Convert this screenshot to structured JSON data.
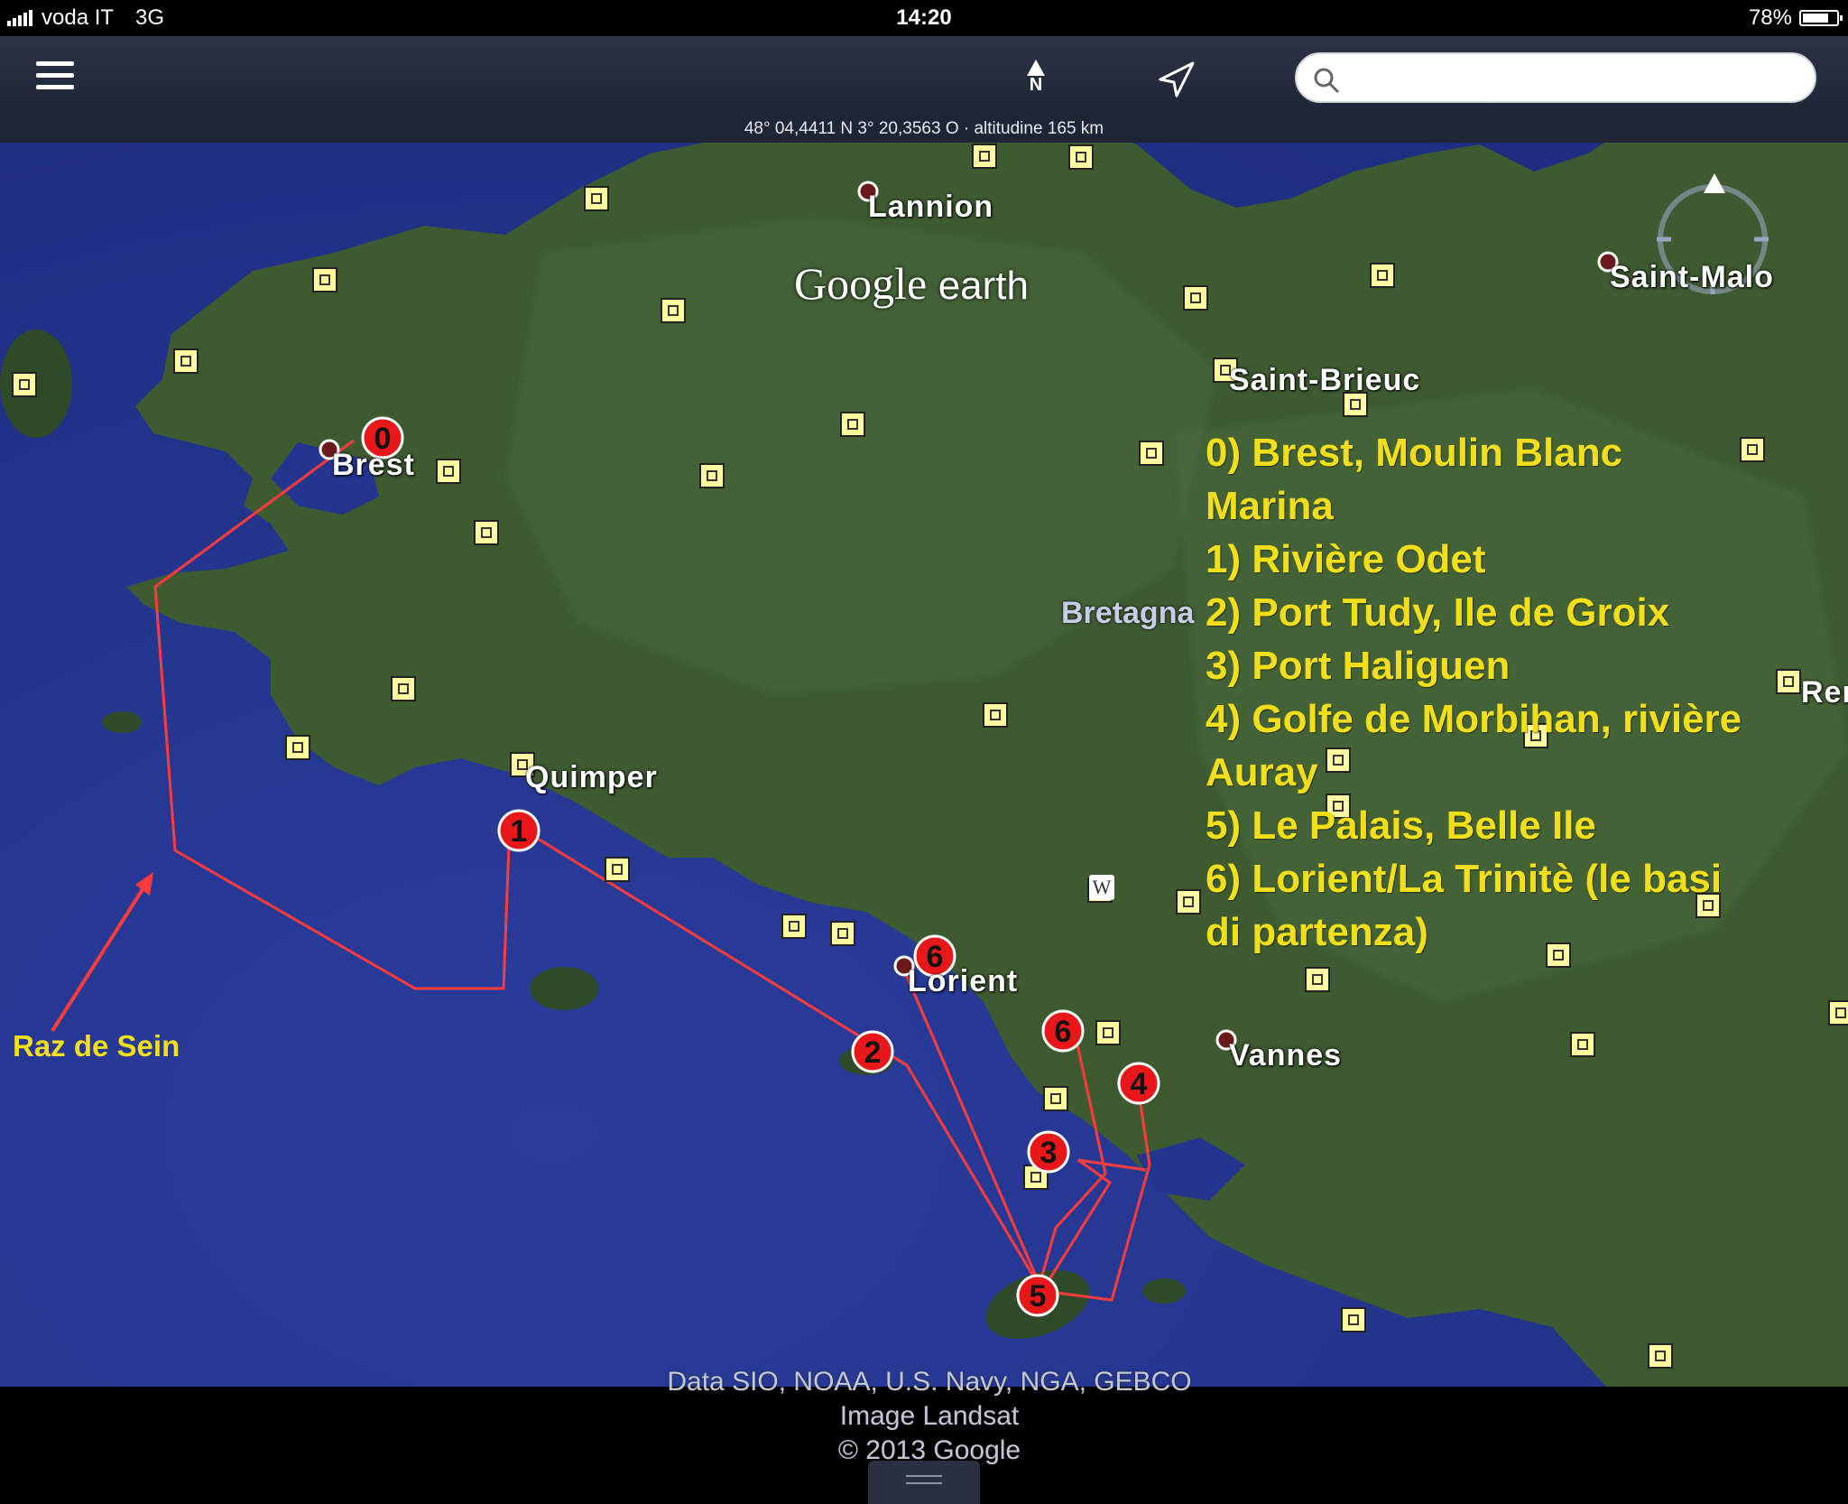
{
  "statusbar": {
    "carrier": "voda IT",
    "network": "3G",
    "time": "14:20",
    "battery_text": "78%",
    "battery_level": 0.78
  },
  "toolbar": {
    "menu_icon": "hamburger-menu-icon",
    "north_icon": "north-arrow-icon",
    "north_letter": "N",
    "locate_icon": "location-arrow-icon",
    "search_placeholder": "",
    "search_icon": "search-icon"
  },
  "coordinates": "48° 04,4411 N  3° 20,3563 O · altitudine 165 km",
  "map": {
    "logo": {
      "google": "Google",
      "earth": "earth"
    },
    "cities": [
      {
        "name": "Lannion"
      },
      {
        "name": "Saint-Malo"
      },
      {
        "name": "Saint-Brieuc"
      },
      {
        "name": "Brest"
      },
      {
        "name": "Quimper"
      },
      {
        "name": "Lorient"
      },
      {
        "name": "Vannes"
      },
      {
        "name": "Ren"
      }
    ],
    "region": "Bretagna",
    "annotation": "Raz de Sein",
    "legend": [
      "0) Brest, Moulin Blanc",
      "Marina",
      "1) Rivière Odet",
      "2) Port Tudy, Ile de Groix",
      "3) Port Haliguen",
      "4) Golfe de Morbihan, rivière",
      "Auray",
      "5) Le Palais, Belle Ile",
      "6) Lorient/La Trinitè (le basi",
      "di partenza)"
    ],
    "markers": [
      "0",
      "1",
      "2",
      "3",
      "4",
      "5",
      "6",
      "6"
    ],
    "credits": [
      "Data SIO, NOAA, U.S. Navy, NGA, GEBCO",
      "Image Landsat",
      "© 2013 Google"
    ],
    "colors": {
      "sea": "#23358f",
      "land": "#3d5a30",
      "route": "#ff3b3b",
      "legend_text": "#f2df19",
      "poi_fill": "#fffb9e"
    }
  }
}
